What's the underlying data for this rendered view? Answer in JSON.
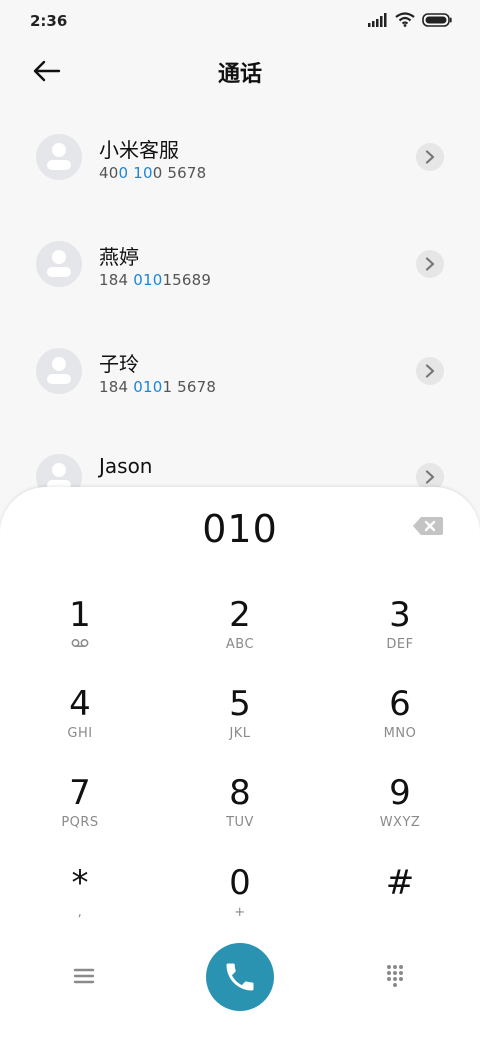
{
  "status_bar": {
    "time": "2:36",
    "icons": [
      "signal-icon",
      "wifi-icon",
      "battery-icon"
    ]
  },
  "header": {
    "title": "通话",
    "back_icon": "arrow-left-icon"
  },
  "contacts": [
    {
      "name": "小米客服",
      "number_parts": [
        {
          "text": "40",
          "hl": false
        },
        {
          "text": "0",
          "hl": true
        },
        {
          "text": " ",
          "hl": false
        },
        {
          "text": "10",
          "hl": true
        },
        {
          "text": "0 5678",
          "hl": false
        }
      ]
    },
    {
      "name": "燕婷",
      "number_parts": [
        {
          "text": "184 ",
          "hl": false
        },
        {
          "text": "010",
          "hl": true
        },
        {
          "text": "15689",
          "hl": false
        }
      ]
    },
    {
      "name": "子玲",
      "number_parts": [
        {
          "text": "184 ",
          "hl": false
        },
        {
          "text": "010",
          "hl": true
        },
        {
          "text": "1 5678",
          "hl": false
        }
      ]
    },
    {
      "name": "Jason",
      "number_parts": []
    }
  ],
  "dialpad": {
    "display": "010",
    "keys": [
      {
        "digit": "1",
        "letters": "voicemail-icon"
      },
      {
        "digit": "2",
        "letters": "ABC"
      },
      {
        "digit": "3",
        "letters": "DEF"
      },
      {
        "digit": "4",
        "letters": "GHI"
      },
      {
        "digit": "5",
        "letters": "JKL"
      },
      {
        "digit": "6",
        "letters": "MNO"
      },
      {
        "digit": "7",
        "letters": "PQRS"
      },
      {
        "digit": "8",
        "letters": "TUV"
      },
      {
        "digit": "9",
        "letters": "WXYZ"
      },
      {
        "digit": "*",
        "letters": ","
      },
      {
        "digit": "0",
        "letters": "+"
      },
      {
        "digit": "#",
        "letters": ""
      }
    ]
  },
  "colors": {
    "highlight": "#1c86d9",
    "call_button": "#2a93b2",
    "avatar_bg": "#e5e6e9"
  }
}
